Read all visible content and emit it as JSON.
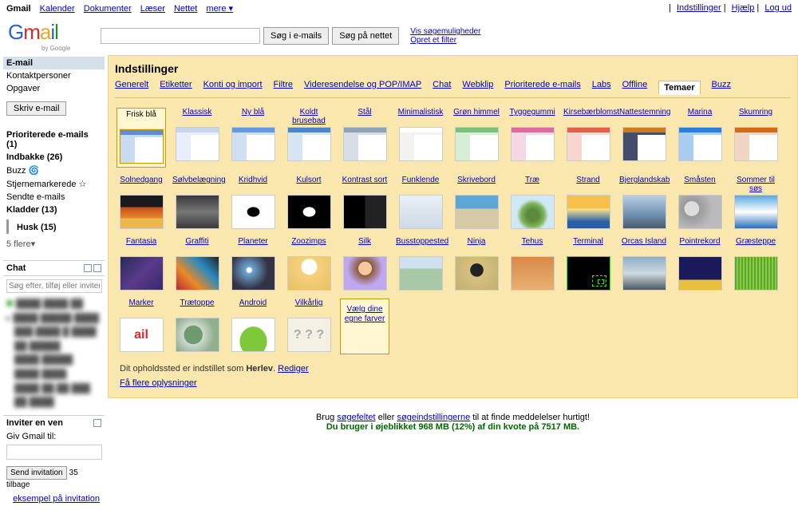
{
  "topbar": {
    "app": "Gmail",
    "links": [
      "Kalender",
      "Dokumenter",
      "Læser",
      "Nettet",
      "mere ▾"
    ],
    "right_links": [
      "Indstillinger",
      "Hjælp",
      "Log ud"
    ]
  },
  "logo_sub": "by Google",
  "search": {
    "btn1": "Søg i e-mails",
    "btn2": "Søg på nettet",
    "side1": "Vis søgemuligheder",
    "side2": "Opret et filter"
  },
  "sidebar": {
    "nav": [
      "E-mail",
      "Kontaktpersoner",
      "Opgaver"
    ],
    "compose": "Skriv e-mail",
    "labels": [
      {
        "t": "Prioriterede e-mails (1)",
        "b": true
      },
      {
        "t": "Indbakke (26)",
        "b": true
      },
      {
        "t": "Buzz 🌀",
        "b": false
      },
      {
        "t": "Stjernemarkerede ☆",
        "b": false
      },
      {
        "t": "Sendte e-mails",
        "b": false
      },
      {
        "t": "Kladder (13)",
        "b": true
      }
    ],
    "husk": "Husk (15)",
    "more": "5 flere▾",
    "chat_title": "Chat",
    "chat_placeholder": "Søg efter, tilføj eller inviter",
    "invite_title": "Inviter en ven",
    "invite_label": "Giv Gmail til:",
    "invite_btn": "Send invitation",
    "invite_count": "35 tilbage",
    "example": "eksempel på invitation"
  },
  "settings": {
    "title": "Indstillinger",
    "tabs": [
      "Generelt",
      "Etiketter",
      "Konti og import",
      "Filtre",
      "Videresendelse og POP/IMAP",
      "Chat",
      "Webklip",
      "Prioriterede e-mails",
      "Labs",
      "Offline",
      "Temaer",
      "Buzz"
    ],
    "tab_selected": "Temaer"
  },
  "themes": [
    {
      "n": "Frisk blå",
      "c": "#5a8fd6",
      "s": "#c9dbf0",
      "sel": true
    },
    {
      "n": "Klassisk",
      "c": "#c6d4ef",
      "s": "#e8eefb"
    },
    {
      "n": "Ny blå",
      "c": "#6699dd",
      "s": "#cfe0f5"
    },
    {
      "n": "Koldt brusebad",
      "c": "#4e87c8",
      "s": "#d6e4f3"
    },
    {
      "n": "Stål",
      "c": "#8fa2b8",
      "s": "#d6dde6"
    },
    {
      "n": "Minimalistisk",
      "c": "#ffffff",
      "s": "#f2f2f2"
    },
    {
      "n": "Grøn himmel",
      "c": "#7cbf7c",
      "s": "#d6edd6"
    },
    {
      "n": "Tyggegummi",
      "c": "#d66fa0",
      "s": "#f5d6e4"
    },
    {
      "n": "Kirsebærblomst",
      "c": "#e25f4a",
      "s": "#f8d6cf"
    },
    {
      "n": "Nattestemning",
      "c": "#d27a1e",
      "s": "#444d6b"
    },
    {
      "n": "Marina",
      "c": "#2a7fd6",
      "s": "#a8cdf0"
    },
    {
      "n": "Skumring",
      "c": "#d26a1e",
      "s": "#f0d6c2"
    },
    {
      "n": "Solnedgang",
      "img": "linear-gradient(#1a1a1a 35%, #c24a1a 35%, #e88a2e 70%, #e8b84a 70%)"
    },
    {
      "n": "Sølvbelægning",
      "img": "linear-gradient(#3a3a3a, #777, #3a3a3a)"
    },
    {
      "n": "Kridhvid",
      "img": "radial-gradient(#000 20%, #fff 22%)",
      "bg": "#fff"
    },
    {
      "n": "Kulsort",
      "img": "radial-gradient(#fff 20%, #000 22%)",
      "bg": "#000"
    },
    {
      "n": "Kontrast sort",
      "img": "linear-gradient(to right, #000 50%, #222 50%)"
    },
    {
      "n": "Funklende",
      "img": "linear-gradient(#e8f0f7, #cfd9e4)"
    },
    {
      "n": "Skrivebord",
      "img": "linear-gradient(#5da6d6 40%, #d6c9a8 40%)"
    },
    {
      "n": "Træ",
      "img": "radial-gradient(circle at 50% 60%, #5a8a3a 20%, #7fb35a 40%, #cfe8f5 55%)"
    },
    {
      "n": "Strand",
      "img": "linear-gradient(#f5c14a 40%, #ffe88a 40%, #2a5fa8 80%)"
    },
    {
      "n": "Bjerglandskab",
      "img": "linear-gradient(#b8cfe4, #6f8faf 60%, #4a5a70)"
    },
    {
      "n": "Småsten",
      "img": "radial-gradient(circle at 30% 40%, #ddd 20%, #999 22%, #bbb 60%)"
    },
    {
      "n": "Sommer til søs",
      "img": "linear-gradient(#5aa8e0, #fff 50%, #2a6fb8)"
    },
    {
      "n": "Fantasia",
      "img": "linear-gradient(135deg,#2a2a5a,#5a3a8a,#3a2a6a)"
    },
    {
      "n": "Graffiti",
      "img": "linear-gradient(45deg,#c02a2a,#e88a2a,#2a8ac0,#222)"
    },
    {
      "n": "Planeter",
      "img": "radial-gradient(circle at 40% 40%, #fff 8%, #6fa8d6 10%, #334 60%)"
    },
    {
      "n": "Zoozimps",
      "img": "radial-gradient(circle at 50% 30%, #fff 25%, #f5d080 26%, #e8c060 100%)"
    },
    {
      "n": "Silk",
      "img": "radial-gradient(circle at 50% 35%, #f5c9a0 22%, #8a5a3a 23%, #c0a8f0 60%)"
    },
    {
      "n": "Busstoppested",
      "img": "linear-gradient(#cfe0ef 35%, #a8c9a8 35%)"
    },
    {
      "n": "Ninja",
      "img": "radial-gradient(circle at 50% 40%, #222 22%, #d6c080 24%, #c0b070 100%)"
    },
    {
      "n": "Tehus",
      "img": "linear-gradient(#d68a4a, #e8b070)"
    },
    {
      "n": "Terminal",
      "c2": "#0f0",
      "bg": "#000",
      "border": "#0f0"
    },
    {
      "n": "Orcas Island",
      "img": "linear-gradient(#8fb0c9, #cfd9df 50%, #4a5a60)"
    },
    {
      "n": "Pointrekord",
      "img": "linear-gradient(#1a1a5a 70%, #e8c040 70%)"
    },
    {
      "n": "Græsteppe",
      "img": "repeating-linear-gradient(90deg,#5aa82a 0 2px,#8ac94a 2px 4px)"
    },
    {
      "n": "Marker",
      "txt": "ail",
      "txtc": "linear-gradient(90deg,#d62a2a,#e88a2a,#2a8a2a)"
    },
    {
      "n": "Trætoppe",
      "img": "radial-gradient(circle at 40% 50%, #6f9a6f 30%, #cfd9cf 32%, #8fb08f 70%)"
    },
    {
      "n": "Android",
      "img": "radial-gradient(ellipse at 50% 70%, #7dc93a 45%, #fff 46%)"
    },
    {
      "n": "Vilkårlig",
      "txt": "? ? ?",
      "bg": "#f5f0e4"
    }
  ],
  "custom_label": "Vælg dine egne farver",
  "location_prefix": "Dit opholdssted er indstillet som ",
  "location_value": "Herlev",
  "location_edit": "Rediger",
  "more_info": "Få flere oplysninger",
  "footer": {
    "line1_pre": "Brug ",
    "line1_a": "søgefeltet",
    "line1_mid": " eller ",
    "line1_b": "søgeindstillingerne",
    "line1_post": " til at finde meddelelser hurtigt!",
    "line2": "Du bruger i øjeblikket 968 MB (12%) af din kvote på 7517 MB."
  }
}
